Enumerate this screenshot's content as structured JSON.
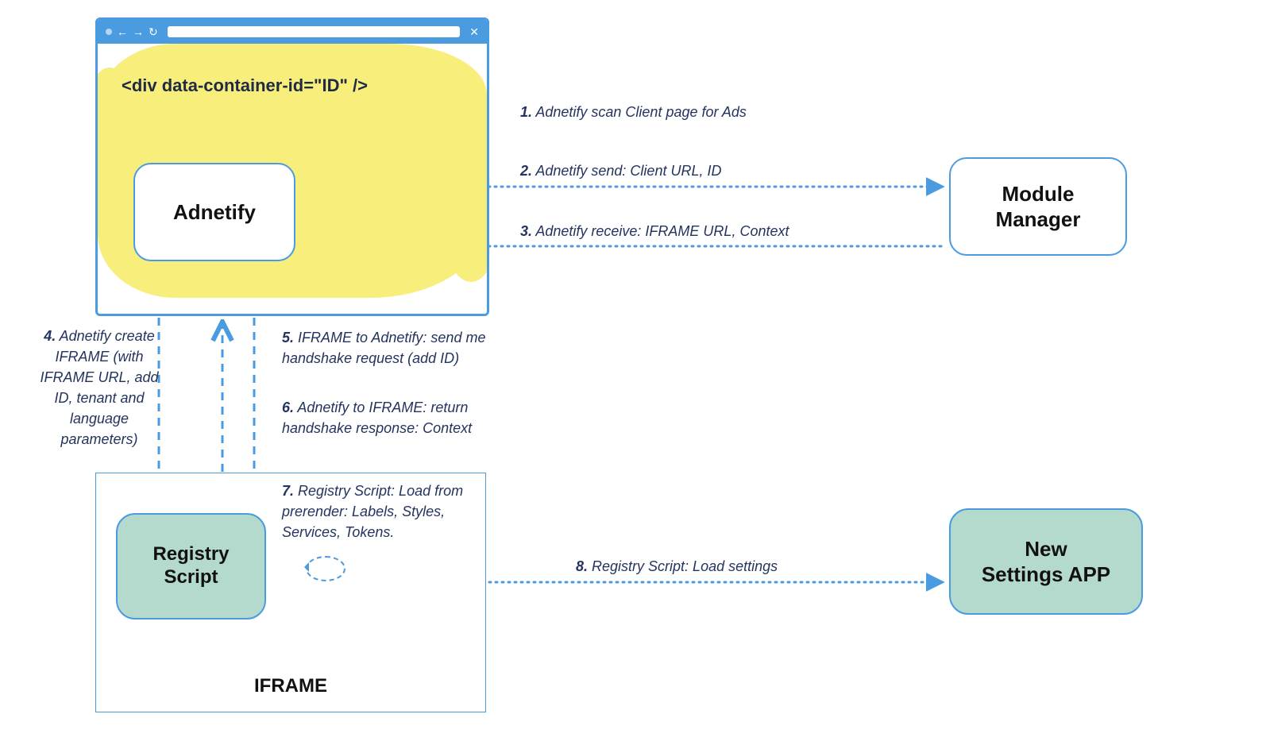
{
  "browser": {
    "code_snippet": "<div data-container-id=\"ID\" />",
    "adnetify_label": "Adnetify"
  },
  "iframe": {
    "container_label": "IFRAME",
    "registry_label": "Registry\nScript"
  },
  "right": {
    "module_manager_label": "Module\nManager",
    "settings_app_label": "New\nSettings APP"
  },
  "steps": {
    "s1_num": "1.",
    "s1_text": "Adnetify scan Client page for Ads",
    "s2_num": "2.",
    "s2_text": "Adnetify send: Client URL, ID",
    "s3_num": "3.",
    "s3_text": "Adnetify receive: IFRAME URL, Context",
    "s4_num": "4.",
    "s4_text": "Adnetify create IFRAME (with IFRAME URL, add ID, tenant and language parameters)",
    "s5_num": "5.",
    "s5_text": "IFRAME to Adnetify: send me handshake request (add ID)",
    "s6_num": "6.",
    "s6_text": "Adnetify to IFRAME: return handshake response: Context",
    "s7_num": "7.",
    "s7_text": "Registry Script: Load from prerender: Labels, Styles, Services, Tokens.",
    "s8_num": "8.",
    "s8_text": "Registry Script: Load settings"
  },
  "colors": {
    "blue": "#4a9be0",
    "green": "#b4d9cd",
    "yellow": "#f7ee7c",
    "text": "#25345f"
  }
}
